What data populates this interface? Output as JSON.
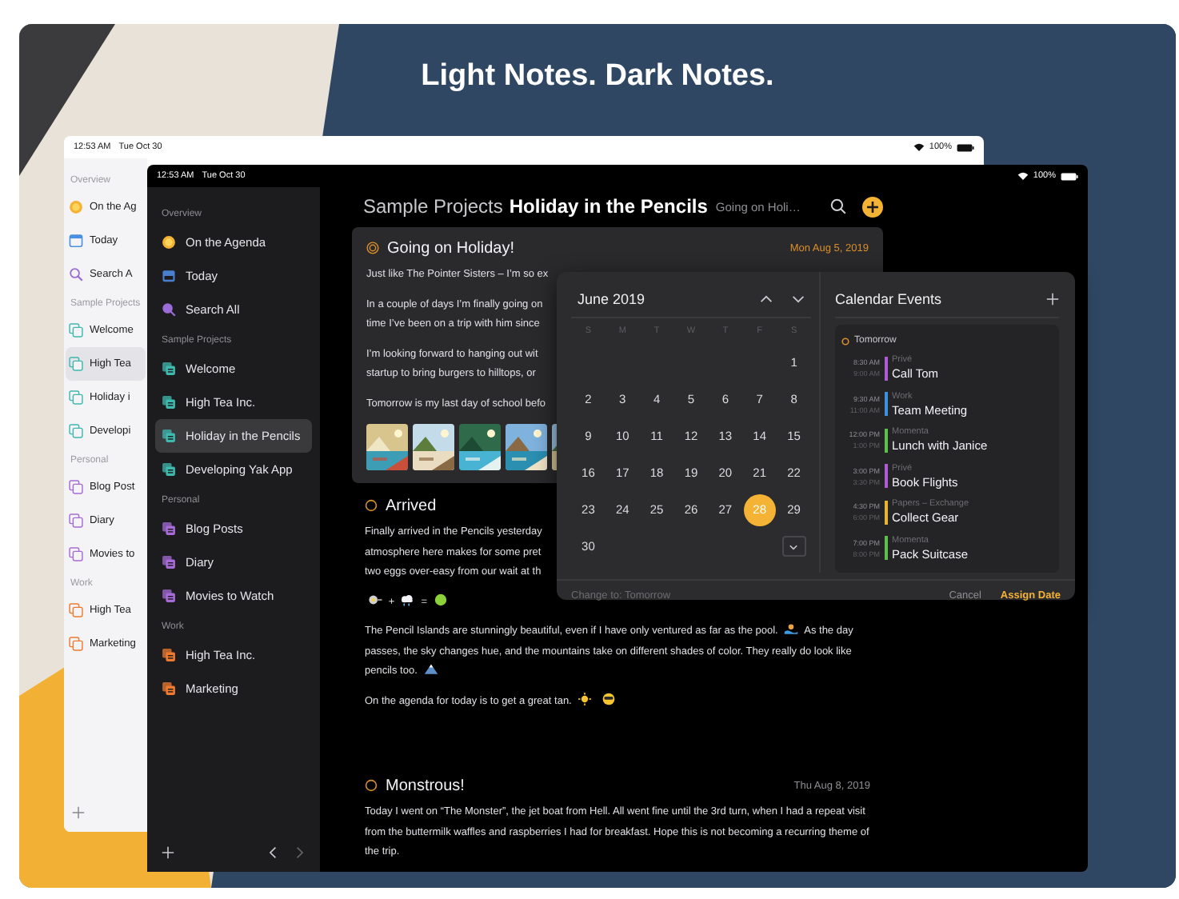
{
  "banner": {
    "title": "Light Notes. Dark Notes."
  },
  "light_device": {
    "status_bar": {
      "time": "12:53 AM",
      "date": "Tue Oct 30",
      "battery": "100%"
    },
    "sidebar": {
      "sections": [
        {
          "title": "Overview",
          "items": [
            {
              "label": "On the Ag",
              "kind": "agenda",
              "selected": false
            },
            {
              "label": "Today",
              "kind": "today",
              "selected": false
            },
            {
              "label": "Search A",
              "kind": "search",
              "selected": false
            }
          ]
        },
        {
          "title": "Sample Projects",
          "color": "#3fb8ad",
          "items": [
            {
              "label": "Welcome",
              "kind": "project",
              "selected": false
            },
            {
              "label": "High Tea",
              "kind": "project",
              "selected": true
            },
            {
              "label": "Holiday i",
              "kind": "project",
              "selected": false
            },
            {
              "label": "Developi",
              "kind": "project",
              "selected": false
            }
          ]
        },
        {
          "title": "Personal",
          "color": "#a66bd6",
          "items": [
            {
              "label": "Blog Post",
              "kind": "project",
              "selected": false
            },
            {
              "label": "Diary",
              "kind": "project",
              "selected": false
            },
            {
              "label": "Movies to",
              "kind": "project",
              "selected": false
            }
          ]
        },
        {
          "title": "Work",
          "color": "#ee7a30",
          "items": [
            {
              "label": "High Tea",
              "kind": "project",
              "selected": false
            },
            {
              "label": "Marketing",
              "kind": "project",
              "selected": false
            }
          ]
        }
      ]
    }
  },
  "dark_device": {
    "status_bar": {
      "time": "12:53 AM",
      "date": "Tue Oct 30",
      "battery": "100%"
    },
    "sidebar": {
      "sections": [
        {
          "title": "Overview",
          "items": [
            {
              "label": "On the Agenda",
              "kind": "agenda",
              "selected": false
            },
            {
              "label": "Today",
              "kind": "today",
              "selected": false
            },
            {
              "label": "Search All",
              "kind": "search",
              "selected": false
            }
          ]
        },
        {
          "title": "Sample Projects",
          "color": "#3fb8ad",
          "items": [
            {
              "label": "Welcome",
              "kind": "project",
              "selected": false
            },
            {
              "label": "High Tea Inc.",
              "kind": "project",
              "selected": false
            },
            {
              "label": "Holiday in the Pencils",
              "kind": "project",
              "selected": true
            },
            {
              "label": "Developing Yak App",
              "kind": "project",
              "selected": false
            }
          ]
        },
        {
          "title": "Personal",
          "color": "#a66bd6",
          "items": [
            {
              "label": "Blog Posts",
              "kind": "project",
              "selected": false
            },
            {
              "label": "Diary",
              "kind": "project",
              "selected": false
            },
            {
              "label": "Movies to Watch",
              "kind": "project",
              "selected": false
            }
          ]
        },
        {
          "title": "Work",
          "color": "#ee7a30",
          "items": [
            {
              "label": "High Tea Inc.",
              "kind": "project",
              "selected": false
            },
            {
              "label": "Marketing",
              "kind": "project",
              "selected": false
            }
          ]
        }
      ]
    },
    "header": {
      "group": "Sample Projects",
      "title": "Holiday in the Pencils",
      "subtitle": "Going on Holi…"
    },
    "notes": [
      {
        "kind": "card",
        "title": "Going on Holiday!",
        "date": "Mon Aug 5, 2019",
        "paragraphs": [
          {
            "parts": [
              {
                "text": "Just like The Pointer Sisters – I’m so ex"
              }
            ]
          },
          {
            "parts": [
              {
                "text": "In a couple of days I’m finally going on\ntime I’ve been on a trip with him since"
              }
            ]
          },
          {
            "parts": [
              {
                "text": "I’m looking forward to hanging out wit\nstartup to bring burgers to hilltops, or"
              }
            ]
          },
          {
            "parts": [
              {
                "text": "Tomorrow is my last day of school befo"
              }
            ]
          }
        ],
        "photos": [
          {
            "kind": "picture"
          },
          {
            "kind": "picture"
          },
          {
            "kind": "picture"
          },
          {
            "kind": "picture"
          },
          {
            "kind": "picture"
          }
        ]
      },
      {
        "kind": "plain",
        "title": "Arrived",
        "paragraphs": [
          {
            "parts": [
              {
                "text": "Finally arrived in the Pencils yesterday\natmosphere here makes for some pret\ntwo eggs over-easy from our wait at th"
              }
            ]
          },
          {
            "parts": [
              {
                "kind": "emoji"
              },
              {
                "text": "+"
              },
              {
                "kind": "emoji"
              },
              {
                "text": "="
              },
              {
                "kind": "emoji"
              }
            ]
          },
          {
            "parts": [
              {
                "text": "The Pencil Islands are stunningly beautiful, even if I have only ventured as far as the pool."
              },
              {
                "kind": "emoji"
              },
              {
                "text": "As the day passes, the sky changes hue, and the mountains take on different shades of color. They really do look like pencils too."
              },
              {
                "kind": "emoji"
              }
            ]
          },
          {
            "parts": [
              {
                "text": "On the agenda for today is to get a great tan."
              },
              {
                "kind": "emoji"
              },
              {
                "kind": "emoji"
              }
            ]
          }
        ]
      },
      {
        "kind": "plain",
        "title": "Monstrous!",
        "date": "Thu Aug 8, 2019",
        "paragraphs": [
          {
            "parts": [
              {
                "text": "Today I went on “The Monster”, the jet boat from Hell. All went fine until the 3rd turn, when I had a repeat visit from the buttermilk waffles and raspberries I had for breakfast. Hope this is not becoming a recurring theme of the trip."
              }
            ]
          }
        ]
      }
    ],
    "popover": {
      "calendar": {
        "month": "June 2019",
        "weekdays": [
          "S",
          "M",
          "T",
          "W",
          "T",
          "F",
          "S"
        ],
        "weeks": [
          [
            {
              "label": "1",
              "selected": false
            }
          ],
          [
            {
              "label": "2",
              "selected": false
            },
            {
              "label": "3",
              "selected": false
            },
            {
              "label": "4",
              "selected": false
            },
            {
              "label": "5",
              "selected": false
            },
            {
              "label": "6",
              "selected": false
            },
            {
              "label": "7",
              "selected": false
            },
            {
              "label": "8",
              "selected": false
            }
          ],
          [
            {
              "label": "9",
              "selected": false
            },
            {
              "label": "10",
              "selected": false
            },
            {
              "label": "11",
              "selected": false
            },
            {
              "label": "12",
              "selected": false
            },
            {
              "label": "13",
              "selected": false
            },
            {
              "label": "14",
              "selected": false
            },
            {
              "label": "15",
              "selected": false
            }
          ],
          [
            {
              "label": "16",
              "selected": false
            },
            {
              "label": "17",
              "selected": false
            },
            {
              "label": "18",
              "selected": false
            },
            {
              "label": "19",
              "selected": false
            },
            {
              "label": "20",
              "selected": false
            },
            {
              "label": "21",
              "selected": false
            },
            {
              "label": "22",
              "selected": false
            }
          ],
          [
            {
              "label": "23",
              "selected": false
            },
            {
              "label": "24",
              "selected": false
            },
            {
              "label": "25",
              "selected": false
            },
            {
              "label": "26",
              "selected": false
            },
            {
              "label": "27",
              "selected": false
            },
            {
              "label": "28",
              "selected": true
            },
            {
              "label": "29",
              "selected": false
            }
          ],
          [
            {
              "label": "30",
              "selected": false
            }
          ]
        ]
      },
      "events_panel": {
        "title": "Calendar Events",
        "day_label": "Tomorrow",
        "events": [
          {
            "start": "8:30 AM",
            "end": "9:00 AM",
            "calendar": "Privé",
            "title": "Call Tom",
            "color": "#b05bd6"
          },
          {
            "start": "9:30 AM",
            "end": "11:00 AM",
            "calendar": "Work",
            "title": "Team Meeting",
            "color": "#3d8fe0"
          },
          {
            "start": "12:00 PM",
            "end": "1:00 PM",
            "calendar": "Momenta",
            "title": "Lunch with Janice",
            "color": "#5cc04a"
          },
          {
            "start": "3:00 PM",
            "end": "3:30 PM",
            "calendar": "Privé",
            "title": "Book Flights",
            "color": "#b05bd6"
          },
          {
            "start": "4:30 PM",
            "end": "6:00 PM",
            "calendar": "Papers – Exchange",
            "title": "Collect Gear",
            "color": "#e8b531"
          },
          {
            "start": "7:00 PM",
            "end": "8:00 PM",
            "calendar": "Momenta",
            "title": "Pack Suitcase",
            "color": "#5cc04a"
          }
        ]
      },
      "footer": {
        "hint": "Change to: Tomorrow",
        "cancel": "Cancel",
        "confirm": "Assign Date"
      }
    }
  }
}
